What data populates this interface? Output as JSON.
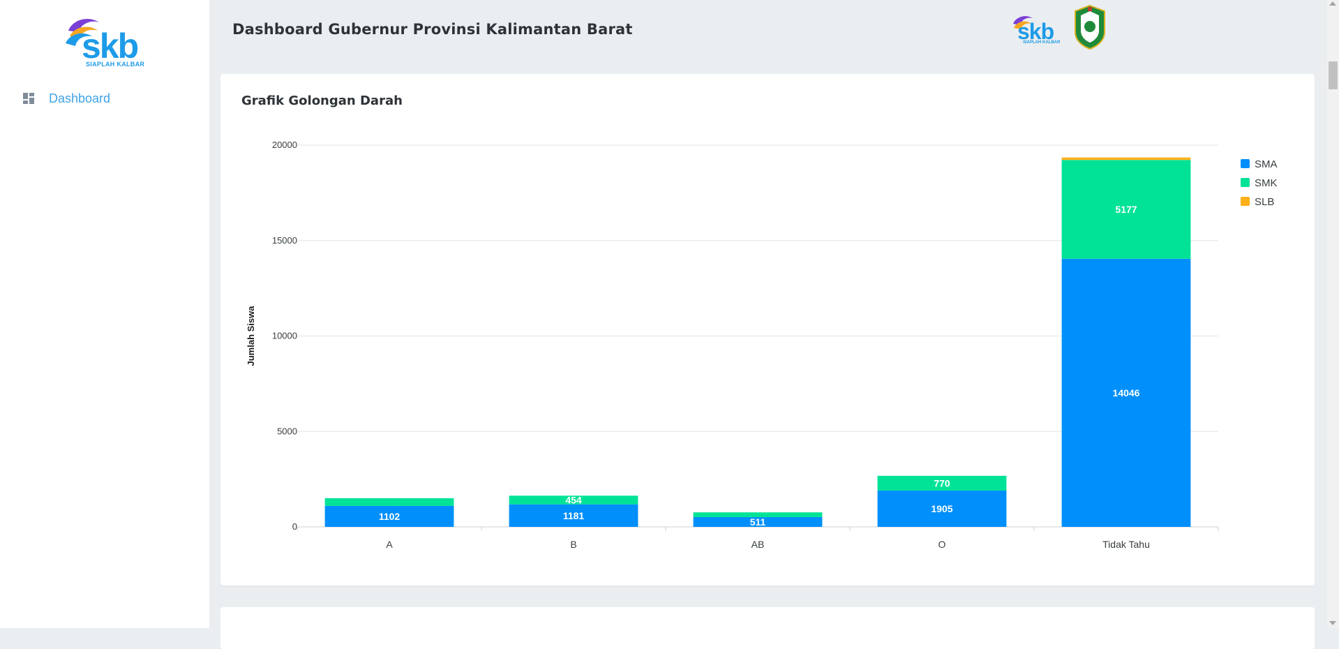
{
  "app": {
    "brand": "skb",
    "brand_sub": "SIAPLAH KALBAR",
    "title": "Dashboard Gubernur Provinsi Kalimantan Barat"
  },
  "sidebar": {
    "items": [
      {
        "label": "Dashboard",
        "icon": "dashboard-icon"
      }
    ]
  },
  "colors": {
    "accent": "#3fa3e6",
    "sma": "#008ffb",
    "smk": "#00e396",
    "slb": "#feb019"
  },
  "card": {
    "title": "Grafik Golongan Darah"
  },
  "chart_data": {
    "type": "bar",
    "stacked": true,
    "categories": [
      "A",
      "B",
      "AB",
      "O",
      "Tidak Tahu"
    ],
    "series": [
      {
        "name": "SMA",
        "values": [
          1102,
          1181,
          511,
          1905,
          14046
        ]
      },
      {
        "name": "SMK",
        "values": [
          400,
          454,
          250,
          770,
          5177
        ]
      },
      {
        "name": "SLB",
        "values": [
          0,
          0,
          0,
          0,
          130
        ]
      }
    ],
    "data_labels": [
      [
        "1102",
        "1181",
        "511",
        "1905",
        "14046"
      ],
      [
        "",
        "454",
        "",
        "770",
        "5177"
      ],
      [
        "",
        "",
        "",
        "",
        ""
      ]
    ],
    "title": "",
    "xlabel": "",
    "ylabel": "Jumlah Siswa",
    "ylim": [
      0,
      20000
    ],
    "yticks": [
      0,
      5000,
      10000,
      15000,
      20000
    ],
    "grid": true,
    "legend_position": "right"
  }
}
